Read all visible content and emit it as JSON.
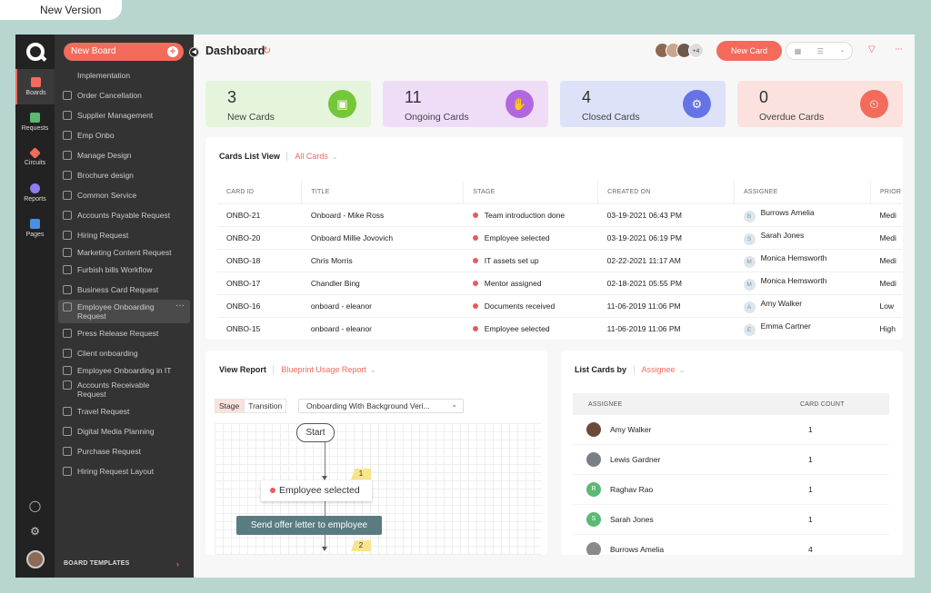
{
  "version_label": "New Version",
  "rail": {
    "items": [
      {
        "label": "Boards",
        "color": "#f26b5b"
      },
      {
        "label": "Requests",
        "color": "#5bb974"
      },
      {
        "label": "Circuits",
        "color": "#f26b5b"
      },
      {
        "label": "Reports",
        "color": "#8e7cf0"
      },
      {
        "label": "Pages",
        "color": "#4a8fe0"
      }
    ]
  },
  "boards": {
    "new_board_label": "New Board",
    "items": [
      {
        "label": "Implementation"
      },
      {
        "label": "Order Cancellation"
      },
      {
        "label": "Supplier Management"
      },
      {
        "label": "Emp Onbo"
      },
      {
        "label": "Manage Design"
      },
      {
        "label": "Brochure design"
      },
      {
        "label": "Common Service"
      },
      {
        "label": "Accounts Payable Request"
      },
      {
        "label": "Hiring Request"
      },
      {
        "label": "Marketing Content Request"
      },
      {
        "label": "Furbish bills Workflow"
      },
      {
        "label": "Business Card Request"
      },
      {
        "label": "Employee Onboarding Request"
      },
      {
        "label": "Press Release Request"
      },
      {
        "label": "Client onboarding"
      },
      {
        "label": "Employee Onboarding in IT"
      },
      {
        "label": "Accounts Receivable Request"
      },
      {
        "label": "Travel Request"
      },
      {
        "label": "Digital Media Planning"
      },
      {
        "label": "Purchase Request"
      },
      {
        "label": "Hiring Request Layout"
      }
    ],
    "templates_label": "BOARD TEMPLATES"
  },
  "header": {
    "title": "Dashboard",
    "avatar_more": "+4",
    "new_card_label": "New Card"
  },
  "stats": [
    {
      "value": "3",
      "label": "New Cards",
      "bg": "#e4f5dc",
      "accent": "#76c63a"
    },
    {
      "value": "11",
      "label": "Ongoing Cards",
      "bg": "#efddf8",
      "accent": "#b267e0"
    },
    {
      "value": "4",
      "label": "Closed Cards",
      "bg": "#dde2f8",
      "accent": "#6673e6"
    },
    {
      "value": "0",
      "label": "Overdue Cards",
      "bg": "#fbe2df",
      "accent": "#f26b5b"
    }
  ],
  "cards_list": {
    "title": "Cards List View",
    "filter": "All Cards",
    "columns": [
      "CARD ID",
      "TITLE",
      "STAGE",
      "CREATED ON",
      "ASSIGNEE",
      "PRIOR"
    ],
    "rows": [
      {
        "id": "ONBO-21",
        "title": "Onboard - Mike Ross",
        "stage": "Team introduction done",
        "created": "03-19-2021 06:43 PM",
        "initial": "B",
        "assignee": "Burrows Amelia",
        "priority": "Medi"
      },
      {
        "id": "ONBO-20",
        "title": "Onboard Millie Jovovich",
        "stage": "Employee selected",
        "created": "03-19-2021 06:19 PM",
        "initial": "S",
        "assignee": "Sarah Jones",
        "priority": "Medi"
      },
      {
        "id": "ONBO-18",
        "title": "Chris Morris",
        "stage": "IT assets set up",
        "created": "02-22-2021 11:17 AM",
        "initial": "M",
        "assignee": "Monica Hemsworth",
        "priority": "Medi"
      },
      {
        "id": "ONBO-17",
        "title": "Chandler Bing",
        "stage": "Mentor assigned",
        "created": "02-18-2021 05:55 PM",
        "initial": "M",
        "assignee": "Monica Hemsworth",
        "priority": "Medi"
      },
      {
        "id": "ONBO-16",
        "title": "onboard - eleanor",
        "stage": "Documents received",
        "created": "11-06-2019 11:06 PM",
        "initial": "A",
        "assignee": "Amy Walker",
        "priority": "Low"
      },
      {
        "id": "ONBO-15",
        "title": "onboard - eleanor",
        "stage": "Employee selected",
        "created": "11-06-2019 11:06 PM",
        "initial": "E",
        "assignee": "Emma Cartner",
        "priority": "High"
      }
    ]
  },
  "report": {
    "title": "View Report",
    "filter": "Blueprint Usage Report",
    "tab_stage": "Stage",
    "tab_transition": "Transition",
    "blueprint_select": "Onboarding With Background Veri...",
    "start_label": "Start",
    "stage_node": "Employee selected",
    "flag_1": "1",
    "transition_node": "Send offer letter to employee",
    "flag_2": "2"
  },
  "list_by": {
    "title": "List Cards by",
    "filter": "Assignee",
    "col_assignee": "ASSIGNEE",
    "col_count": "CARD COUNT",
    "rows": [
      {
        "initial": "",
        "name": "Amy Walker",
        "count": "1",
        "color": "#6b4a3a"
      },
      {
        "initial": "",
        "name": "Lewis Gardner",
        "count": "1",
        "color": "#7a7f88"
      },
      {
        "initial": "R",
        "name": "Raghav Rao",
        "count": "1",
        "color": "#5bb974"
      },
      {
        "initial": "S",
        "name": "Sarah Jones",
        "count": "1",
        "color": "#5bb974"
      },
      {
        "initial": "",
        "name": "Burrows Amelia",
        "count": "4",
        "color": "#8a8a8a"
      }
    ]
  }
}
